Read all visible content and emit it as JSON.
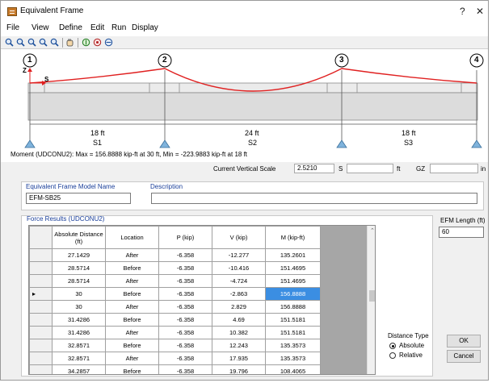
{
  "window": {
    "title": "Equivalent Frame",
    "help_label": "?",
    "close_label": "✕"
  },
  "menu": [
    "File",
    "View",
    "Define",
    "Edit",
    "Run",
    "Display"
  ],
  "toolbar_icons": [
    "zoom-in-icon",
    "zoom-window-icon",
    "zoom-previous-icon",
    "zoom-fit-icon",
    "zoom-out-icon",
    "pan-hand-icon",
    "display-options-icon",
    "rotate-icon",
    "view-3d-icon"
  ],
  "diagram": {
    "nodes": [
      "1",
      "2",
      "3",
      "4"
    ],
    "axis_z": "Z",
    "axis_s": "S",
    "spans": [
      {
        "length": "18 ft",
        "name": "S1"
      },
      {
        "length": "24 ft",
        "name": "S2"
      },
      {
        "length": "18 ft",
        "name": "S3"
      }
    ],
    "moment_text": "Moment  (UDCONU2):  Max = 156.8888 kip-ft at 30 ft,   Min = -223.9883 kip-ft at 18 ft",
    "moment_color": "#e02020",
    "support_color": "#7fb3dc"
  },
  "scale": {
    "label": "Current Vertical Scale",
    "value": "2.5210",
    "s_label": "S",
    "s_unit": "ft",
    "gz_label": "GZ",
    "gz_unit": "in"
  },
  "model": {
    "name_label": "Equivalent Frame Model Name",
    "name_value": "EFM-SB25",
    "desc_label": "Description",
    "desc_value": ""
  },
  "results": {
    "label": "Force Results  (UDCONU2)",
    "columns": [
      "Absolute Distance\n(ft)",
      "Location",
      "P  (kip)",
      "V  (kip)",
      "M  (kip-ft)"
    ],
    "rows": [
      [
        "27.1429",
        "After",
        "-6.358",
        "-12.277",
        "135.2601"
      ],
      [
        "28.5714",
        "Before",
        "-6.358",
        "-10.416",
        "151.4695"
      ],
      [
        "28.5714",
        "After",
        "-6.358",
        "-4.724",
        "151.4695"
      ],
      [
        "30",
        "Before",
        "-6.358",
        "-2.863",
        "156.8888"
      ],
      [
        "30",
        "After",
        "-6.358",
        "2.829",
        "156.8888"
      ],
      [
        "31.4286",
        "Before",
        "-6.358",
        "4.69",
        "151.5181"
      ],
      [
        "31.4286",
        "After",
        "-6.358",
        "10.382",
        "151.5181"
      ],
      [
        "32.8571",
        "Before",
        "-6.358",
        "12.243",
        "135.3573"
      ],
      [
        "32.8571",
        "After",
        "-6.358",
        "17.935",
        "135.3573"
      ],
      [
        "34.2857",
        "Before",
        "-6.358",
        "19.796",
        "108.4065"
      ]
    ],
    "current_row_marker": "▸"
  },
  "efm_length": {
    "label": "EFM Length  (ft)",
    "value": "60"
  },
  "distance_type": {
    "label": "Distance Type",
    "options": [
      "Absolute",
      "Relative"
    ],
    "selected": "Absolute"
  },
  "buttons": {
    "ok": "OK",
    "cancel": "Cancel"
  }
}
